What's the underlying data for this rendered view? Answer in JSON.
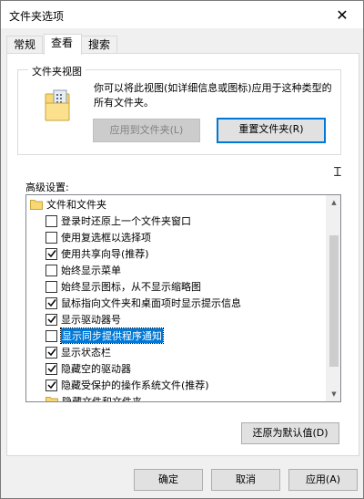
{
  "window": {
    "title": "文件夹选项",
    "close_glyph": "✕"
  },
  "tabs": [
    {
      "label": "常规",
      "active": false
    },
    {
      "label": "查看",
      "active": true
    },
    {
      "label": "搜索",
      "active": false
    }
  ],
  "folder_views": {
    "title": "文件夹视图",
    "description": "你可以将此视图(如详细信息或图标)应用于这种类型的所有文件夹。",
    "apply_button": "应用到文件夹(L)",
    "reset_button": "重置文件夹(R)"
  },
  "advanced": {
    "label": "高级设置:",
    "root": "文件和文件夹",
    "items": [
      {
        "label": "登录时还原上一个文件夹窗口",
        "checked": false
      },
      {
        "label": "使用复选框以选择项",
        "checked": false
      },
      {
        "label": "使用共享向导(推荐)",
        "checked": true
      },
      {
        "label": "始终显示菜单",
        "checked": false
      },
      {
        "label": "始终显示图标，从不显示缩略图",
        "checked": false
      },
      {
        "label": "鼠标指向文件夹和桌面项时显示提示信息",
        "checked": true
      },
      {
        "label": "显示驱动器号",
        "checked": true
      },
      {
        "label": "显示同步提供程序通知",
        "checked": false,
        "selected": true
      },
      {
        "label": "显示状态栏",
        "checked": true
      },
      {
        "label": "隐藏空的驱动器",
        "checked": true
      },
      {
        "label": "隐藏受保护的操作系统文件(推荐)",
        "checked": true
      }
    ],
    "sub_folder": "隐藏文件和文件夹",
    "restore_button": "还原为默认值(D)"
  },
  "footer": {
    "ok": "确定",
    "cancel": "取消",
    "apply": "应用(A)"
  },
  "colors": {
    "accent": "#0078d7",
    "folder": "#f8d775"
  }
}
